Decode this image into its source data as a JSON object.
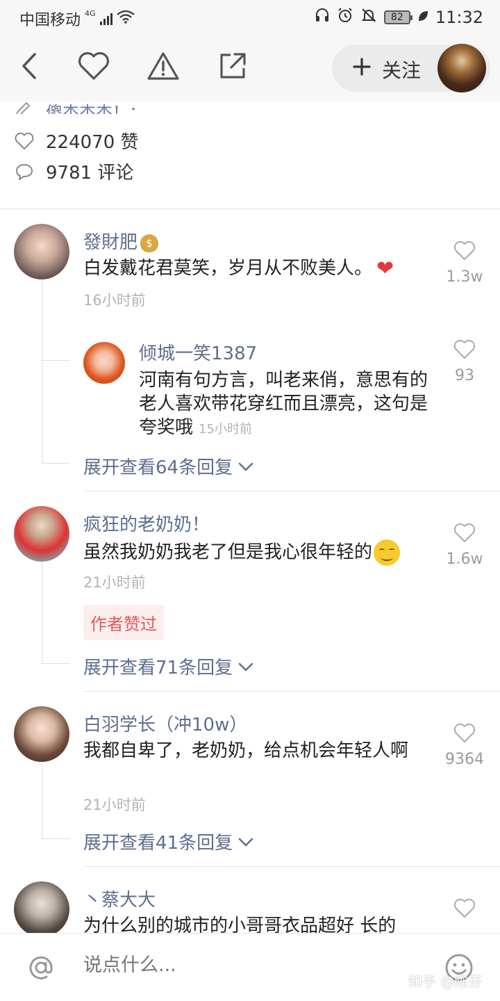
{
  "status_bar": {
    "carrier": "中国移动",
    "network": "4G",
    "battery": "82",
    "time": "11:32"
  },
  "toolbar": {
    "follow_label": "关注"
  },
  "article": {
    "partial_line": "傻杰杰杰！：...",
    "likes": "224070 赞",
    "comments": "9781 评论"
  },
  "comments": [
    {
      "author": "發財肥",
      "text": "白发戴花君莫笑，岁月从不败美人。",
      "time": "16小时前",
      "likes": "1.3w",
      "reply": {
        "author": "倾城一笑1387",
        "text": "河南有句方言，叫老来俏，意思有的老人喜欢带花穿红而且漂亮，这句是夸奖哦",
        "time": "15小时前",
        "likes": "93"
      },
      "expand": "展开查看64条回复"
    },
    {
      "author": "疯狂的老奶奶！",
      "text": "虽然我奶奶我老了但是我心很年轻的",
      "time": "21小时前",
      "likes": "1.6w",
      "badge": "作者赞过",
      "expand": "展开查看71条回复"
    },
    {
      "author": "白羽学长（冲10w）",
      "text": "我都自卑了，老奶奶，给点机会年轻人啊",
      "time": "21小时前",
      "likes": "9364",
      "expand": "展开查看41条回复"
    },
    {
      "author": "丶蔡大大",
      "text": "为什么别的城市的小哥哥衣品超好 长的"
    }
  ],
  "bottom_bar": {
    "placeholder": "说点什么..."
  },
  "watermark": "知乎 @陈芬"
}
